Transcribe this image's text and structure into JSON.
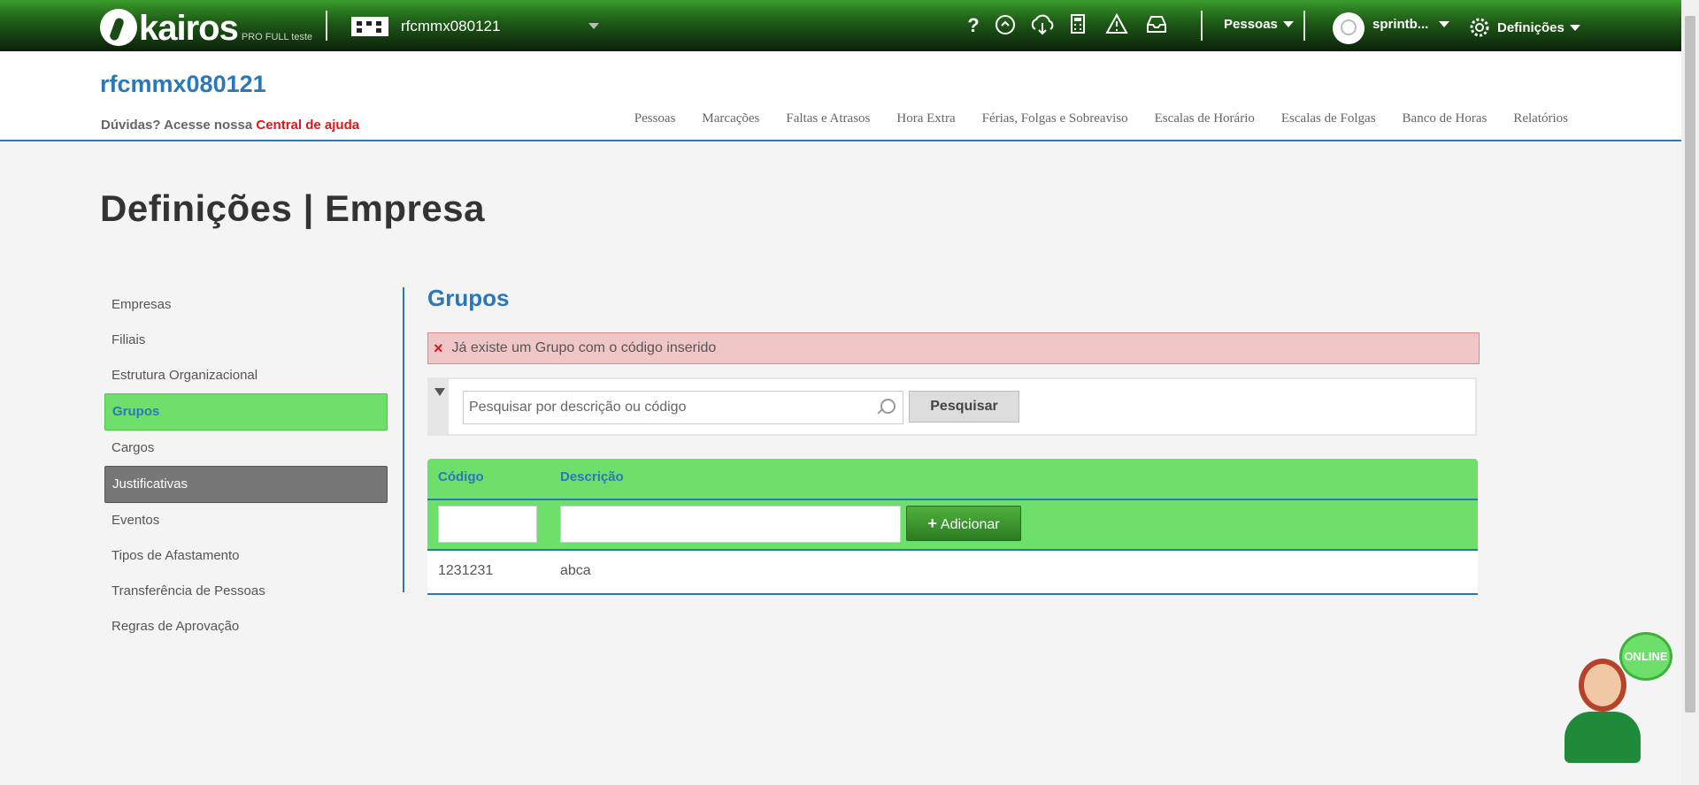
{
  "topbar": {
    "brand": "kairos",
    "brand_sub": "PRO FULL teste",
    "company": "rfcmmx080121",
    "icons": [
      "help-icon",
      "chat-bubble-icon",
      "cloud-download-icon",
      "calculator-icon",
      "warning-icon",
      "inbox-icon"
    ],
    "help_glyph": "?",
    "pessoas_label": "Pessoas",
    "user_label": "sprintb...",
    "settings_label": "Definições"
  },
  "header": {
    "company_title": "rfcmmx080121",
    "help_prefix": "Dúvidas? Acesse nossa",
    "help_link": "Central de ajuda",
    "nav": [
      "Pessoas",
      "Marcações",
      "Faltas e Atrasos",
      "Hora Extra",
      "Férias, Folgas e Sobreaviso",
      "Escalas de Horário",
      "Escalas de Folgas",
      "Banco de Horas",
      "Relatórios"
    ]
  },
  "page_title": "Definições | Empresa",
  "sidebar": {
    "items": [
      "Empresas",
      "Filiais",
      "Estrutura Organizacional",
      "Grupos",
      "Cargos",
      "Justificativas",
      "Eventos",
      "Tipos de Afastamento",
      "Transferência de Pessoas",
      "Regras de Aprovação"
    ],
    "active": "Grupos",
    "hovered": "Justificativas"
  },
  "section_title": "Grupos",
  "alert": {
    "icon": "×",
    "message": "Já existe um Grupo com o código inserido"
  },
  "search": {
    "placeholder": "Pesquisar por descrição ou código",
    "button": "Pesquisar"
  },
  "grid": {
    "columns": [
      "Código",
      "Descrição"
    ],
    "add_button": "Adicionar",
    "add_glyph": "+",
    "rows": [
      {
        "codigo": "1231231",
        "descricao": "abca"
      }
    ]
  },
  "chat_badge": "ONLINE",
  "colors": {
    "brand_green": "#6ddf6b",
    "link_blue": "#2a78b8",
    "alert_red": "#e8131a"
  }
}
